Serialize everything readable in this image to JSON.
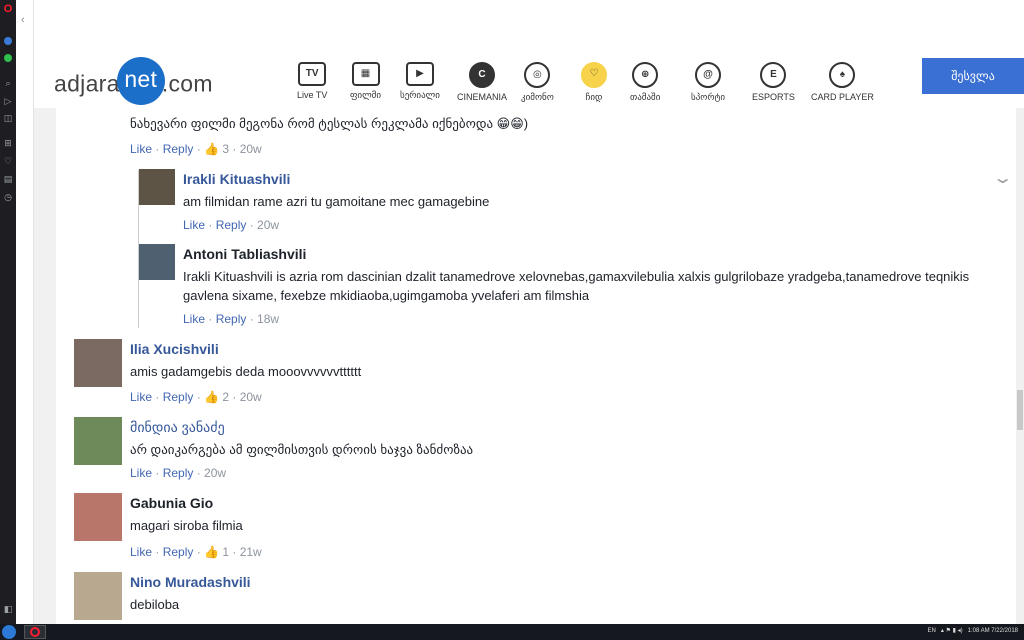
{
  "header": {
    "logo_pre": "adjara",
    "logo_mid": "net",
    "logo_post": ".com",
    "nav": [
      {
        "icon": "tv-icon",
        "glyph": "TV",
        "label": "Live TV"
      },
      {
        "icon": "film-icon",
        "glyph": "▦",
        "label": "ფილმი"
      },
      {
        "icon": "play-icon",
        "glyph": "▶",
        "label": "სერიალი"
      },
      {
        "icon": "cinemania-icon",
        "glyph": "C",
        "label": "CINEMANIA"
      },
      {
        "icon": "aperture-icon",
        "glyph": "◎",
        "label": "კიმონო"
      },
      {
        "icon": "heart-icon",
        "glyph": "♡",
        "label": "ჩიდ"
      },
      {
        "icon": "gamepad-icon",
        "glyph": "⊕",
        "label": "თამაში"
      },
      {
        "icon": "at-icon",
        "glyph": "@",
        "label": "სპორტი"
      },
      {
        "icon": "esports-icon",
        "glyph": "E",
        "label": "ESPORTS"
      },
      {
        "icon": "spade-icon",
        "glyph": "♠",
        "label": "CARD PLAYER"
      }
    ],
    "login": "შესვლა"
  },
  "comments": {
    "top": {
      "text": "ნახევარი ფილმი მეგონა რომ ტესლას რეკლამა იქნებოდა 😁😁)",
      "like": "Like",
      "reply": "Reply",
      "likes": "3",
      "time": "20w"
    },
    "replies": [
      {
        "author": "Irakli Kituashvili",
        "text": "am filmidan rame azri tu gamoitane mec gamagebine",
        "like": "Like",
        "reply": "Reply",
        "time": "20w"
      },
      {
        "author": "Antoni Tabliashvili",
        "text": "Irakli Kituashvili is azria rom dascinian dzalit tanamedrove xelovnebas,gamaxvilebulia xalxis gulgrilobaze yradgeba,tanamedrove teqnikis gavlena sixame, fexebze mkidiaoba,ugimgamoba yvelaferi am filmshia",
        "like": "Like",
        "reply": "Reply",
        "time": "18w"
      }
    ],
    "list": [
      {
        "author": "Ilia Xucishvili",
        "text": "amis gadamgebis deda mooovvvvvvtttttt",
        "like": "Like",
        "reply": "Reply",
        "likes": "2",
        "time": "20w"
      },
      {
        "author": "მინდია ვანაძე",
        "text": "არ დაიკარგება ამ ფილმისთვის დროის ხაჯვა ზანძოზაა",
        "like": "Like",
        "reply": "Reply",
        "likes": "",
        "time": "20w"
      },
      {
        "author": "Gabunia Gio",
        "text": "magari siroba filmia",
        "like": "Like",
        "reply": "Reply",
        "likes": "1",
        "time": "21w"
      },
      {
        "author": "Nino Muradashvili",
        "text": "debiloba",
        "like": "",
        "reply": "",
        "likes": "",
        "time": ""
      }
    ]
  },
  "taskbar": {
    "lang": "EN",
    "time": "1:08 AM",
    "date": "7/22/2018"
  }
}
